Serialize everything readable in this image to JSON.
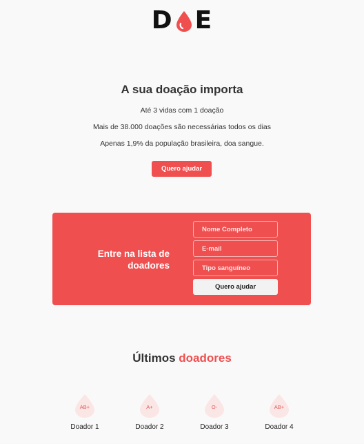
{
  "brand": {
    "logo_left": "D",
    "logo_right": "E",
    "accent_color": "#f04f50"
  },
  "hero": {
    "title": "A sua doação importa",
    "lines": [
      "Até 3 vidas com 1 doação",
      "Mais de 38.000 doações são necessárias todos os dias",
      "Apenas 1,9% da população brasileira, doa sangue."
    ],
    "button_label": "Quero ajudar"
  },
  "signup": {
    "title_line1": "Entre na lista de",
    "title_line2": "doadores",
    "name_placeholder": "Nome Completo",
    "email_placeholder": "E-mail",
    "blood_type_placeholder": "Tipo sanguíneo",
    "button_label": "Quero ajudar"
  },
  "donors": {
    "title_plain": "Últimos",
    "title_accent": "doadores",
    "items": [
      {
        "blood_type": "AB+",
        "name": "Doador 1",
        "icon": "blood-drop-icon"
      },
      {
        "blood_type": "A+",
        "name": "Doador 2",
        "icon": "blood-drop-icon"
      },
      {
        "blood_type": "O-",
        "name": "Doador 3",
        "icon": "blood-drop-icon"
      },
      {
        "blood_type": "AB+",
        "name": "Doador 4",
        "icon": "blood-drop-icon"
      }
    ]
  }
}
